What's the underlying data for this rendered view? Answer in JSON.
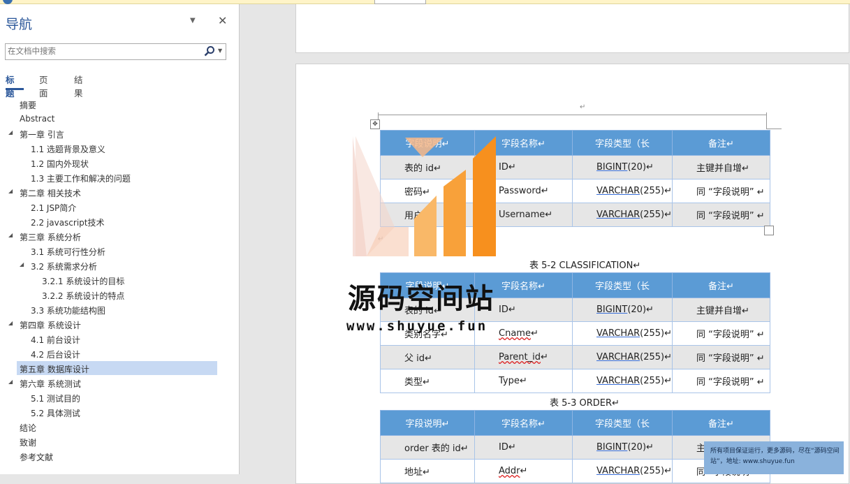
{
  "nav": {
    "title": "导航",
    "search_placeholder": "在文档中搜索",
    "tabs": [
      "标题",
      "页面",
      "结果"
    ],
    "tree": [
      {
        "label": "摘要",
        "level": 0,
        "arrow": ""
      },
      {
        "label": "Abstract",
        "level": 0,
        "arrow": ""
      },
      {
        "label": "第一章 引言",
        "level": 0,
        "arrow": "◢"
      },
      {
        "label": "1.1 选题背景及意义",
        "level": 1,
        "arrow": ""
      },
      {
        "label": "1.2 国内外现状",
        "level": 1,
        "arrow": ""
      },
      {
        "label": "1.3 主要工作和解决的问题",
        "level": 1,
        "arrow": ""
      },
      {
        "label": "第二章 相关技术",
        "level": 0,
        "arrow": "◢"
      },
      {
        "label": "2.1 JSP简介",
        "level": 1,
        "arrow": ""
      },
      {
        "label": "2.2 javascript技术",
        "level": 1,
        "arrow": ""
      },
      {
        "label": "第三章 系统分析",
        "level": 0,
        "arrow": "◢"
      },
      {
        "label": "3.1 系统可行性分析",
        "level": 1,
        "arrow": ""
      },
      {
        "label": "3.2 系统需求分析",
        "level": 1,
        "arrow": "◢"
      },
      {
        "label": "3.2.1 系统设计的目标",
        "level": 2,
        "arrow": ""
      },
      {
        "label": "3.2.2 系统设计的特点",
        "level": 2,
        "arrow": ""
      },
      {
        "label": "3.3 系统功能结构图",
        "level": 1,
        "arrow": ""
      },
      {
        "label": "第四章 系统设计",
        "level": 0,
        "arrow": "◢"
      },
      {
        "label": "4.1 前台设计",
        "level": 1,
        "arrow": ""
      },
      {
        "label": "4.2 后台设计",
        "level": 1,
        "arrow": ""
      },
      {
        "label": "第五章 数据库设计",
        "level": 0,
        "arrow": "",
        "selected": true
      },
      {
        "label": "第六章 系统测试",
        "level": 0,
        "arrow": "◢"
      },
      {
        "label": "5.1 测试目的",
        "level": 1,
        "arrow": ""
      },
      {
        "label": "5.2 具体测试",
        "level": 1,
        "arrow": ""
      },
      {
        "label": "结论",
        "level": 0,
        "arrow": ""
      },
      {
        "label": "致谢",
        "level": 0,
        "arrow": ""
      },
      {
        "label": "参考文献",
        "level": 0,
        "arrow": ""
      }
    ]
  },
  "doc": {
    "para_mark": "↵",
    "move_glyph": "✥",
    "headers": [
      "字段说明↵",
      "字段名称↵",
      "字段类型（长",
      "备注↵"
    ],
    "table1": [
      [
        "表的 id↵",
        "ID↵",
        "BIGINT(20)↵",
        "主键并自增↵"
      ],
      [
        "密码↵",
        "Password↵",
        "VARCHAR(255)↵",
        "同 “字段说明” ↵"
      ],
      [
        "用户↵",
        "Username↵",
        "VARCHAR(255)↵",
        "同 “字段说明” ↵"
      ]
    ],
    "caption2": "表  5-2 CLASSIFICATION↵",
    "table2": [
      [
        "表的 id↵",
        "ID↵",
        "BIGINT(20)↵",
        "主键并自增↵"
      ],
      [
        "类别名字↵",
        "Cname↵",
        "VARCHAR(255)↵",
        "同 “字段说明” ↵"
      ],
      [
        "父 id↵",
        "Parent_id↵",
        "VARCHAR(255)↵",
        "同 “字段说明” ↵"
      ],
      [
        "类型↵",
        "Type↵",
        "VARCHAR(255)↵",
        "同 “字段说明” ↵"
      ]
    ],
    "caption3": "表  5-3 ORDER↵",
    "table3": [
      [
        "order 表的 id↵",
        "ID↵",
        "BIGINT(20)↵",
        "主键并自增↵"
      ],
      [
        "地址↵",
        "Addr↵",
        "VARCHAR(255)↵",
        "同 “字段说明” ↵"
      ]
    ]
  },
  "watermark": {
    "title": "源码空间站",
    "url": "www.shuyue.fun",
    "note": "所有项目保证运行，更多源码，尽在“源码空间站”，地址: www.shuyue.fun"
  },
  "colors": {
    "accent": "#2b579a",
    "table_header": "#5b9bd5",
    "selected_row": "#c7d9f3",
    "logo_orange": "#f7901e"
  }
}
